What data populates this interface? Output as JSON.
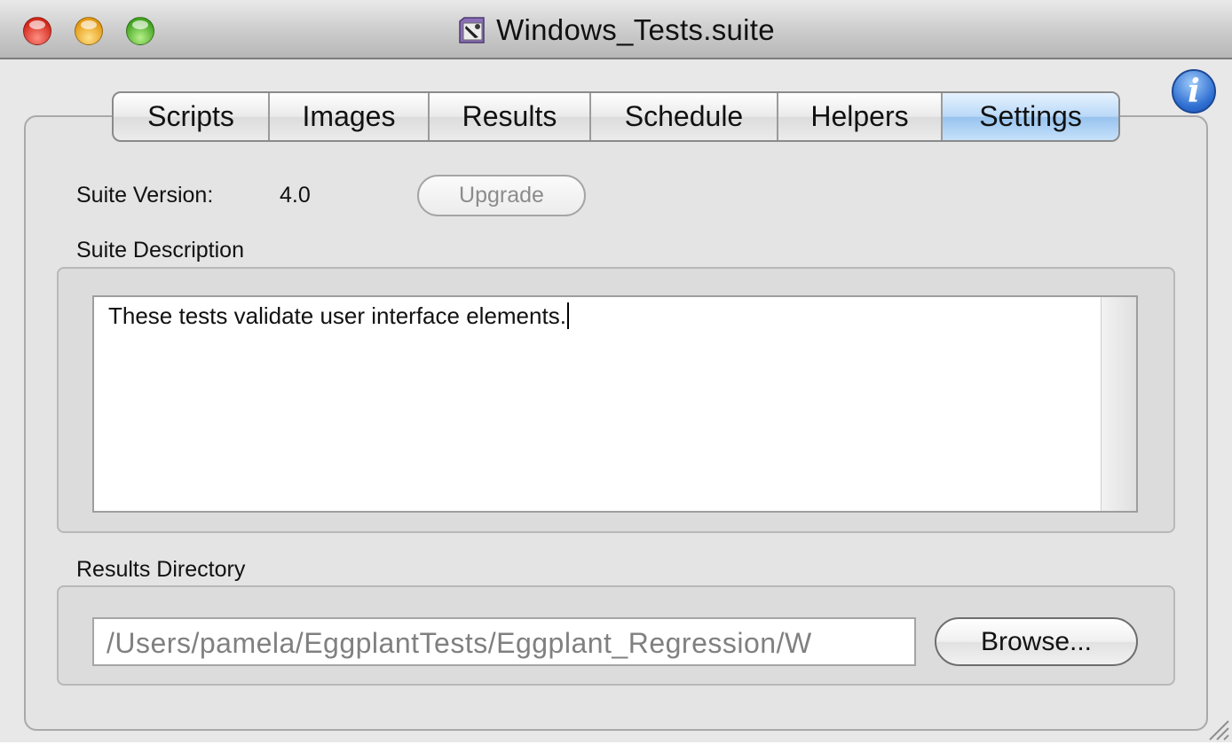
{
  "window": {
    "title": "Windows_Tests.suite"
  },
  "tabs": [
    {
      "label": "Scripts",
      "active": false
    },
    {
      "label": "Images",
      "active": false
    },
    {
      "label": "Results",
      "active": false
    },
    {
      "label": "Schedule",
      "active": false
    },
    {
      "label": "Helpers",
      "active": false
    },
    {
      "label": "Settings",
      "active": true
    }
  ],
  "settings": {
    "version_label": "Suite Version:",
    "version_value": "4.0",
    "upgrade_label": "Upgrade",
    "description_label": "Suite Description",
    "description_text": "These tests validate user interface elements.",
    "results_dir_label": "Results Directory",
    "results_dir_value": "/Users/pamela/EggplantTests/Eggplant_Regression/W",
    "browse_label": "Browse..."
  },
  "info_button": {
    "glyph": "i",
    "icon": "info-icon"
  },
  "colors": {
    "active_tab": "#97c3ee",
    "info_blue": "#2f6fd2",
    "close": "#d3291c",
    "minimize": "#e49a12",
    "zoom": "#44a421"
  }
}
